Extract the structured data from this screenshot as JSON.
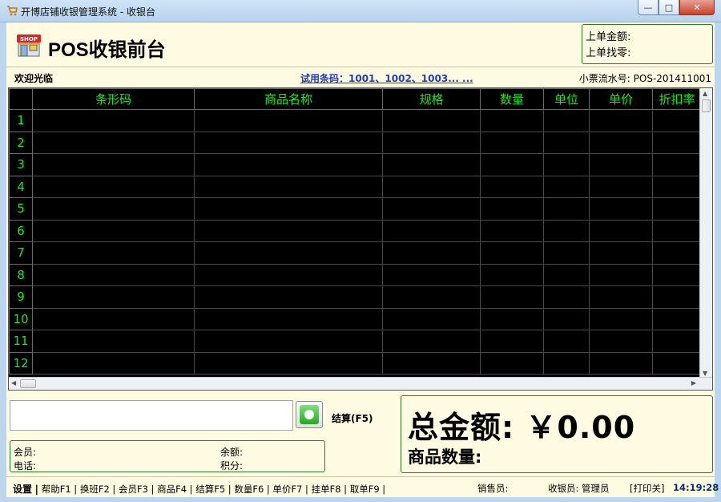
{
  "window": {
    "title": "开博店铺收银管理系统 - 收银台",
    "minimize": "—",
    "maximize": "□",
    "close": "✕"
  },
  "header": {
    "brand": "POS收银前台",
    "logo_text": "SHOP",
    "last_amount_label": "上单金额:",
    "last_change_label": "上单找零:"
  },
  "infobar": {
    "welcome": "欢迎光临",
    "trial_barcodes": "试用条码：1001、1002、1003... ...",
    "ticket_label": "小票流水号: POS-201411001"
  },
  "grid": {
    "columns": [
      "条形码",
      "商品名称",
      "规格",
      "数量",
      "单位",
      "单价",
      "折扣率"
    ],
    "row_numbers": [
      "1",
      "2",
      "3",
      "4",
      "5",
      "6",
      "7",
      "8",
      "9",
      "10",
      "11",
      "12"
    ]
  },
  "entry": {
    "value": "",
    "settle_label": "结算(F5)"
  },
  "member": {
    "member_label": "会员:",
    "phone_label": "电话:",
    "balance_label": "余额:",
    "points_label": "积分:"
  },
  "totals": {
    "total_amount": "总金额: ￥0.00",
    "item_count": "商品数量:"
  },
  "statusbar": {
    "settings": "设置",
    "keys": [
      "帮助F1",
      "换班F2",
      "会员F3",
      "商品F4",
      "结算F5",
      "数量F6",
      "单价F7",
      "挂单F8",
      "取单F9"
    ],
    "seller": "销售员:",
    "cashier": "收银员: 管理员",
    "print": "[打印关]",
    "clock": "14:19:28"
  }
}
